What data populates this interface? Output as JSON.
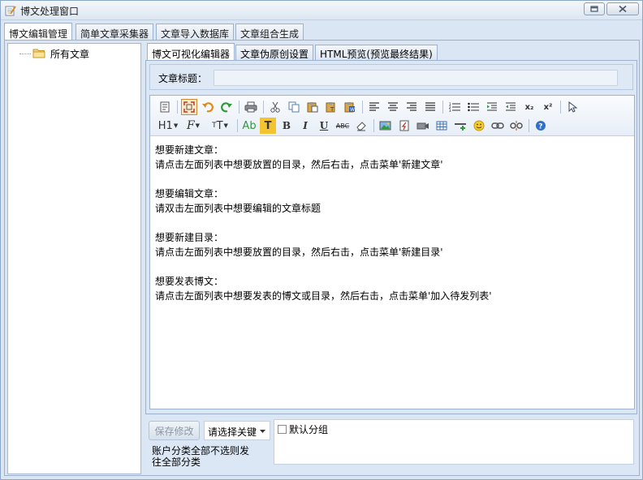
{
  "window": {
    "title": "博文处理窗口"
  },
  "main_tabs": [
    {
      "label": "博文编辑管理"
    },
    {
      "label": "简单文章采集器"
    },
    {
      "label": "文章导入数据库"
    },
    {
      "label": "文章组合生成"
    }
  ],
  "tree": {
    "root_label": "所有文章"
  },
  "sub_tabs": [
    {
      "label": "博文可视化编辑器"
    },
    {
      "label": "文章伪原创设置"
    },
    {
      "label": "HTML预览(预览最终结果)"
    }
  ],
  "editor": {
    "title_label": "文章标题：",
    "title_value": "",
    "toolbar": {
      "heading_label": "H1",
      "font_label": "F",
      "fontsize_label": "T",
      "bold_label": "B",
      "italic_label": "I",
      "underline_label": "U",
      "strike_label": "ABC",
      "forecolor_label": "Ab",
      "backcolor_label": "T",
      "sub_label": "x₂",
      "sup_label": "x²"
    },
    "lines": {
      "l1": "想要新建文章：",
      "l2": "请点击左面列表中想要放置的目录，然后右击，点击菜单'新建文章'",
      "l3": "想要编辑文章：",
      "l4": "请双击左面列表中想要编辑的文章标题",
      "l5": "想要新建目录：",
      "l6": "请点击左面列表中想要放置的目录，然后右击，点击菜单'新建目录'",
      "l7": "想要发表博文：",
      "l8": "请点击左面列表中想要发表的博文或目录，然后右击，点击菜单'加入待发列表'"
    }
  },
  "bottom": {
    "save_label": "保存修改",
    "keyword_select": "请选择关键",
    "default_group_label": "默认分组",
    "hint": "账户分类全部不选则发往全部分类"
  },
  "colors": {
    "window_bg": "#dbe6f4",
    "border": "#9db1cc",
    "selected_tool": "#fde9c6"
  }
}
